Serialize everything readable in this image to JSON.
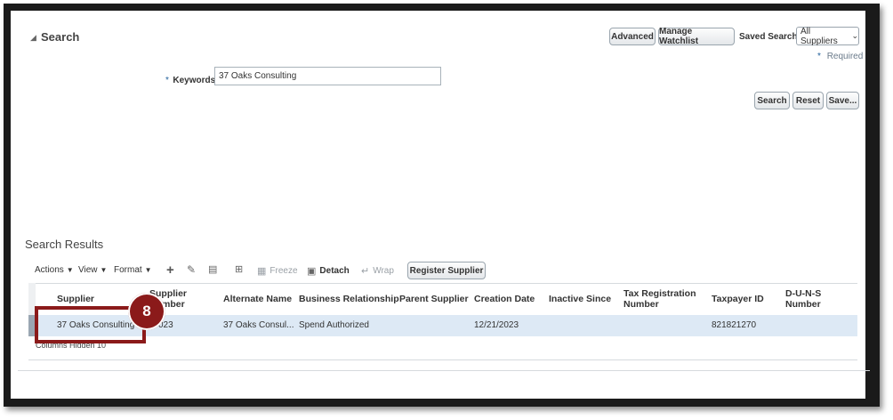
{
  "search": {
    "title": "Search",
    "advanced_label": "Advanced",
    "manage_watchlist_label": "Manage Watchlist",
    "saved_search_label": "Saved Search",
    "saved_search_value": "All Suppliers",
    "required_star": "*",
    "required_label": "Required",
    "keywords_star": "*",
    "keywords_label": "Keywords",
    "keywords_value": "37 Oaks Consulting",
    "search_label": "Search",
    "reset_label": "Reset",
    "save_label": "Save..."
  },
  "results": {
    "title": "Search Results",
    "toolbar": {
      "actions": "Actions",
      "view": "View",
      "format": "Format",
      "freeze": "Freeze",
      "detach": "Detach",
      "wrap": "Wrap",
      "register_supplier": "Register Supplier"
    },
    "columns": {
      "supplier": "Supplier",
      "supplier_number": "Supplier Number",
      "alternate_name": "Alternate Name",
      "business_relationship": "Business Relationship",
      "parent_supplier": "Parent Supplier",
      "creation_date": "Creation Date",
      "inactive_since": "Inactive Since",
      "tax_registration_number": "Tax Registration Number",
      "taxpayer_id": "Taxpayer ID",
      "duns_number": "D-U-N-S Number"
    },
    "row": {
      "supplier": "37 Oaks Consulting",
      "supplier_number": "023",
      "alternate_name": "37 Oaks Consul...",
      "business_relationship": "Spend Authorized",
      "parent_supplier": "",
      "creation_date": "12/21/2023",
      "inactive_since": "",
      "tax_registration_number": "",
      "taxpayer_id": "821821270",
      "duns_number": ""
    },
    "rows_selected_partial": "Columns Hidden  10"
  },
  "callout": {
    "step": "8"
  },
  "colors": {
    "highlight_box": "#8b1a1a",
    "link": "#1f5e9a",
    "row_selected": "#dde9f5"
  }
}
